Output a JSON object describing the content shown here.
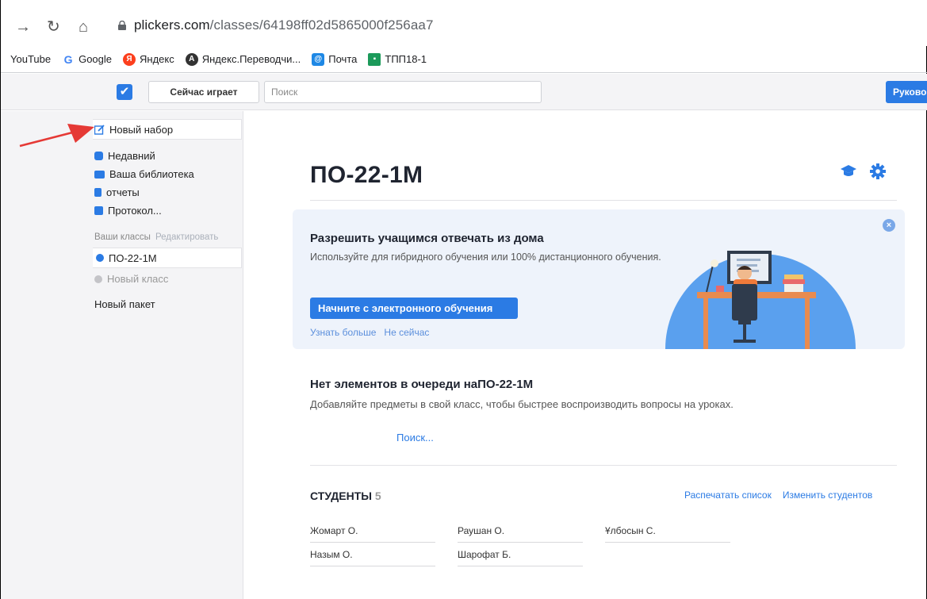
{
  "browser": {
    "url_host": "plickers.com",
    "url_path": "/classes/64198ff02d5865000f256aa7",
    "bookmarks": [
      {
        "label": "YouTube",
        "icon": "youtube-text"
      },
      {
        "label": "Google",
        "icon": "google-g-icon",
        "glyph": "G",
        "color": "#4285f4"
      },
      {
        "label": "Яндекс",
        "icon": "yandex-icon",
        "glyph": "Я",
        "color": "#fc3f1d"
      },
      {
        "label": "Яндекс.Переводчи...",
        "icon": "yandex-translate-icon",
        "glyph": "A",
        "color": "#333333"
      },
      {
        "label": "Почта",
        "icon": "mail-icon",
        "glyph": "@",
        "color": "#1e88e5"
      },
      {
        "label": "ТПП18-1",
        "icon": "classroom-icon",
        "glyph": "▪",
        "color": "#1c9a5a"
      }
    ]
  },
  "topbar": {
    "now_playing": "Сейчас играет",
    "search_placeholder": "Поиск",
    "guide_button": "Руково"
  },
  "sidebar": {
    "new_set": "Новый набор",
    "items": [
      {
        "label": "Недавний",
        "color": "#2b7be4"
      },
      {
        "label": "Ваша библиотека",
        "color": "#2b7be4"
      },
      {
        "label": "отчеты",
        "color": "#2b7be4"
      },
      {
        "label": "Протокол...",
        "color": "#2b7be4"
      }
    ],
    "your_classes": "Ваши классы",
    "edit": "Редактировать",
    "active_class": "ПО-22-1М",
    "new_class": "Новый класс",
    "new_pack": "Новый пакет"
  },
  "main": {
    "title": "ПО-22-1М",
    "banner": {
      "title": "Разрешить учащимся отвечать из дома",
      "subtitle": "Используйте для гибридного обучения или 100% дистанционного обучения.",
      "button": "Начните с электронного обучения",
      "learn_more": "Узнать больше",
      "not_now": "Не сейчас"
    },
    "queue": {
      "title": "Нет элементов в очереди наПО-22-1М",
      "subtitle": "Добавляйте предметы в свой класс, чтобы быстрее воспроизводить вопросы на уроках.",
      "search": "Поиск..."
    },
    "students": {
      "heading": "СТУДЕНТЫ",
      "count": "5",
      "print_list": "Распечатать список",
      "edit_students": "Изменить студентов",
      "list": [
        "Жомарт О.",
        "Раушан О.",
        "Ұлбосын С.",
        "Назым О.",
        "Шарофат Б."
      ]
    }
  },
  "colors": {
    "accent": "#2b7be4",
    "arrow": "#e53935"
  }
}
